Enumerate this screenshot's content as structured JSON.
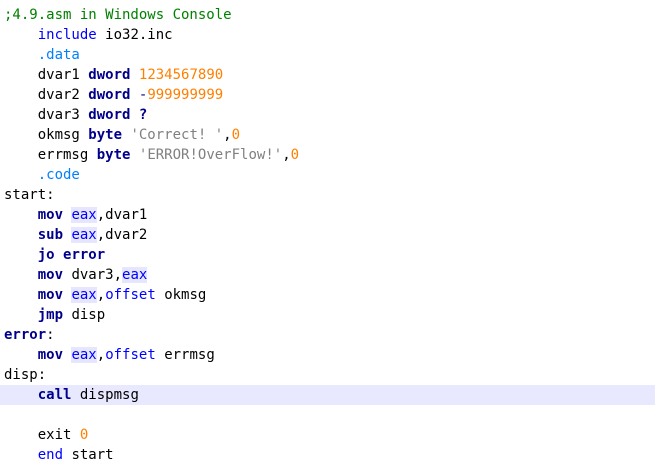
{
  "editor": {
    "indent_unit": "    ",
    "current_line": 19,
    "colors": {
      "comment": "#008000",
      "directive": "#0000ff",
      "section": "#0080ff",
      "keyword": "#00008b",
      "register": "#0000ff",
      "register_bg": "#e6e6ff",
      "number": "#ff8000",
      "string": "#808080",
      "current_line_bg": "#e8e8ff"
    },
    "lines": [
      {
        "indent": 0,
        "tokens": [
          {
            "t": "comment",
            "v": ";4.9.asm in Windows Console"
          }
        ]
      },
      {
        "indent": 1,
        "tokens": [
          {
            "t": "directive",
            "v": "include"
          },
          {
            "t": "plain",
            "v": " io32.inc"
          }
        ]
      },
      {
        "indent": 1,
        "tokens": [
          {
            "t": "section",
            "v": ".data"
          }
        ]
      },
      {
        "indent": 1,
        "tokens": [
          {
            "t": "plain",
            "v": "dvar1 "
          },
          {
            "t": "kw",
            "v": "dword"
          },
          {
            "t": "plain",
            "v": " "
          },
          {
            "t": "num",
            "v": "1234567890"
          }
        ]
      },
      {
        "indent": 1,
        "tokens": [
          {
            "t": "plain",
            "v": "dvar2 "
          },
          {
            "t": "kw",
            "v": "dword"
          },
          {
            "t": "plain",
            "v": " "
          },
          {
            "t": "op",
            "v": "-"
          },
          {
            "t": "num",
            "v": "999999999"
          }
        ]
      },
      {
        "indent": 1,
        "tokens": [
          {
            "t": "plain",
            "v": "dvar3 "
          },
          {
            "t": "kw",
            "v": "dword"
          },
          {
            "t": "plain",
            "v": " "
          },
          {
            "t": "kw",
            "v": "?"
          }
        ]
      },
      {
        "indent": 1,
        "tokens": [
          {
            "t": "plain",
            "v": "okmsg "
          },
          {
            "t": "kw",
            "v": "byte"
          },
          {
            "t": "plain",
            "v": " "
          },
          {
            "t": "str",
            "v": "'Correct! '"
          },
          {
            "t": "plain",
            "v": ","
          },
          {
            "t": "num",
            "v": "0"
          }
        ]
      },
      {
        "indent": 1,
        "tokens": [
          {
            "t": "plain",
            "v": "errmsg "
          },
          {
            "t": "kw",
            "v": "byte"
          },
          {
            "t": "plain",
            "v": " "
          },
          {
            "t": "str",
            "v": "'ERROR!OverFlow!'"
          },
          {
            "t": "plain",
            "v": ","
          },
          {
            "t": "num",
            "v": "0"
          }
        ]
      },
      {
        "indent": 1,
        "tokens": [
          {
            "t": "section",
            "v": ".code"
          }
        ]
      },
      {
        "indent": 0,
        "tokens": [
          {
            "t": "plain",
            "v": "start:"
          }
        ]
      },
      {
        "indent": 1,
        "tokens": [
          {
            "t": "kw",
            "v": "mov"
          },
          {
            "t": "plain",
            "v": " "
          },
          {
            "t": "reg",
            "v": "eax"
          },
          {
            "t": "plain",
            "v": ",dvar1"
          }
        ]
      },
      {
        "indent": 1,
        "tokens": [
          {
            "t": "kw",
            "v": "sub"
          },
          {
            "t": "plain",
            "v": " "
          },
          {
            "t": "reg",
            "v": "eax"
          },
          {
            "t": "plain",
            "v": ",dvar2"
          }
        ]
      },
      {
        "indent": 1,
        "tokens": [
          {
            "t": "kw",
            "v": "jo"
          },
          {
            "t": "plain",
            "v": " "
          },
          {
            "t": "kw",
            "v": "error"
          }
        ]
      },
      {
        "indent": 1,
        "tokens": [
          {
            "t": "kw",
            "v": "mov"
          },
          {
            "t": "plain",
            "v": " dvar3,"
          },
          {
            "t": "reg",
            "v": "eax"
          }
        ]
      },
      {
        "indent": 1,
        "tokens": [
          {
            "t": "kw",
            "v": "mov"
          },
          {
            "t": "plain",
            "v": " "
          },
          {
            "t": "reg",
            "v": "eax"
          },
          {
            "t": "plain",
            "v": ","
          },
          {
            "t": "directive",
            "v": "offset"
          },
          {
            "t": "plain",
            "v": " okmsg"
          }
        ]
      },
      {
        "indent": 1,
        "tokens": [
          {
            "t": "kw",
            "v": "jmp"
          },
          {
            "t": "plain",
            "v": " disp"
          }
        ]
      },
      {
        "indent": 0,
        "tokens": [
          {
            "t": "kw",
            "v": "error"
          },
          {
            "t": "plain",
            "v": ":"
          }
        ]
      },
      {
        "indent": 1,
        "tokens": [
          {
            "t": "kw",
            "v": "mov"
          },
          {
            "t": "plain",
            "v": " "
          },
          {
            "t": "reg",
            "v": "eax"
          },
          {
            "t": "plain",
            "v": ","
          },
          {
            "t": "directive",
            "v": "offset"
          },
          {
            "t": "plain",
            "v": " errmsg"
          }
        ]
      },
      {
        "indent": 0,
        "tokens": [
          {
            "t": "plain",
            "v": "disp:"
          }
        ]
      },
      {
        "indent": 1,
        "tokens": [
          {
            "t": "kw",
            "v": "call"
          },
          {
            "t": "plain",
            "v": " dispmsg"
          }
        ]
      },
      {
        "indent": 0,
        "tokens": []
      },
      {
        "indent": 1,
        "tokens": [
          {
            "t": "plain",
            "v": "exit "
          },
          {
            "t": "num",
            "v": "0"
          }
        ]
      },
      {
        "indent": 1,
        "tokens": [
          {
            "t": "directive",
            "v": "end"
          },
          {
            "t": "plain",
            "v": " start"
          }
        ]
      }
    ]
  }
}
